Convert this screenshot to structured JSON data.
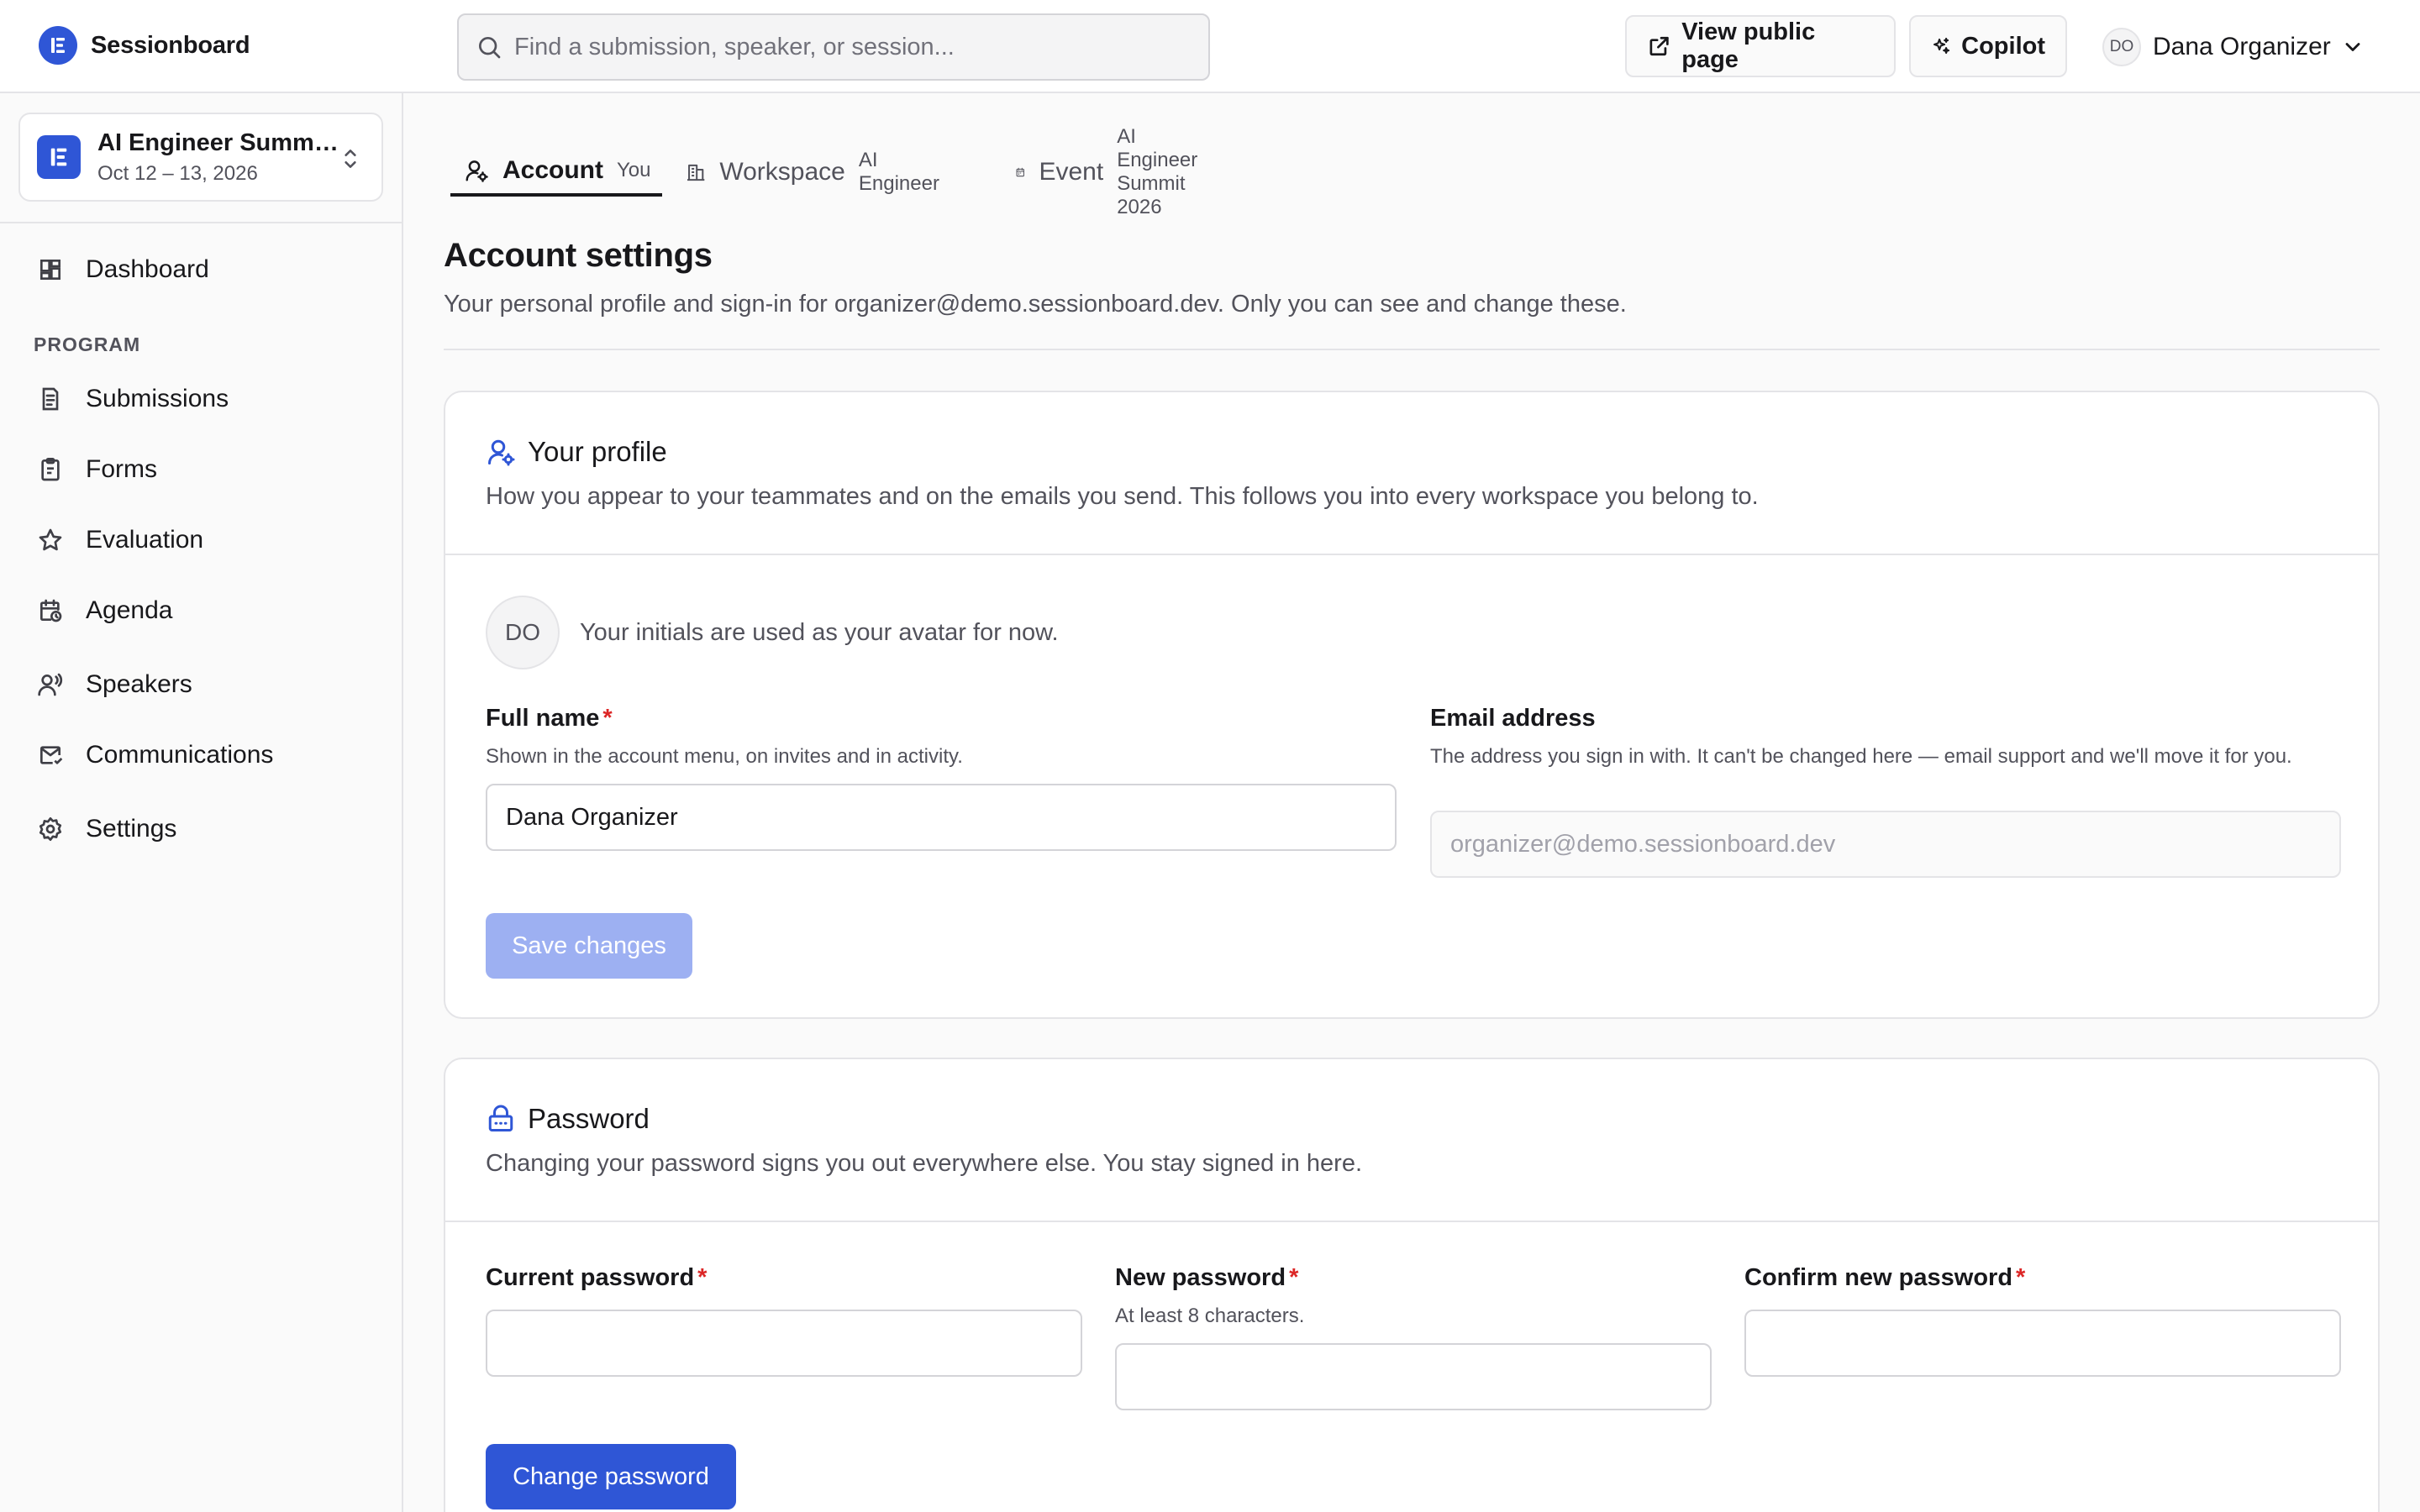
{
  "brand": {
    "name": "Sessionboard"
  },
  "search": {
    "placeholder": "Find a submission, speaker, or session..."
  },
  "header": {
    "view_public_label": "View public page",
    "copilot_label": "Copilot",
    "user": {
      "initials": "DO",
      "name": "Dana Organizer"
    }
  },
  "event": {
    "name": "AI Engineer Summit 2026",
    "dates": "Oct 12 – 13, 2026"
  },
  "sidebar": {
    "dashboard_label": "Dashboard",
    "section_label": "PROGRAM",
    "items": [
      {
        "label": "Submissions",
        "icon": "submissions-icon"
      },
      {
        "label": "Forms",
        "icon": "clipboard-icon"
      },
      {
        "label": "Evaluation",
        "icon": "star-icon"
      },
      {
        "label": "Agenda",
        "icon": "calendar-clock-icon"
      },
      {
        "label": "Speakers",
        "icon": "speaker-icon"
      },
      {
        "label": "Communications",
        "icon": "mail-icon"
      },
      {
        "label": "Settings",
        "icon": "gear-icon"
      }
    ]
  },
  "tabs": [
    {
      "label": "Account",
      "sub": "You"
    },
    {
      "label": "Workspace",
      "sub": "AI Engineer"
    },
    {
      "label": "Event",
      "sub": "AI Engineer Summit 2026"
    }
  ],
  "page": {
    "title": "Account settings",
    "subtitle": "Your personal profile and sign-in for organizer@demo.sessionboard.dev. Only you can see and change these."
  },
  "profile": {
    "title": "Your profile",
    "description": "How you appear to your teammates and on the emails you send. This follows you into every workspace you belong to.",
    "avatar_initials": "DO",
    "avatar_note": "Your initials are used as your avatar for now.",
    "full_name": {
      "label": "Full name",
      "required_mark": "*",
      "help": "Shown in the account menu, on invites and in activity.",
      "value": "Dana Organizer"
    },
    "email": {
      "label": "Email address",
      "help": "The address you sign in with. It can't be changed here — email support and we'll move it for you.",
      "placeholder": "organizer@demo.sessionboard.dev"
    },
    "save_label": "Save changes"
  },
  "password": {
    "title": "Password",
    "description": "Changing your password signs you out everywhere else. You stay signed in here.",
    "current": {
      "label": "Current password",
      "required_mark": "*"
    },
    "new": {
      "label": "New password",
      "required_mark": "*",
      "help": "At least 8 characters."
    },
    "confirm": {
      "label": "Confirm new password",
      "required_mark": "*"
    },
    "submit_label": "Change password"
  },
  "colors": {
    "accent": "#2f56d6",
    "accent_disabled": "#9db0f2",
    "required": "#dc2626",
    "border": "#e4e4e7",
    "muted_text": "#52525b"
  }
}
